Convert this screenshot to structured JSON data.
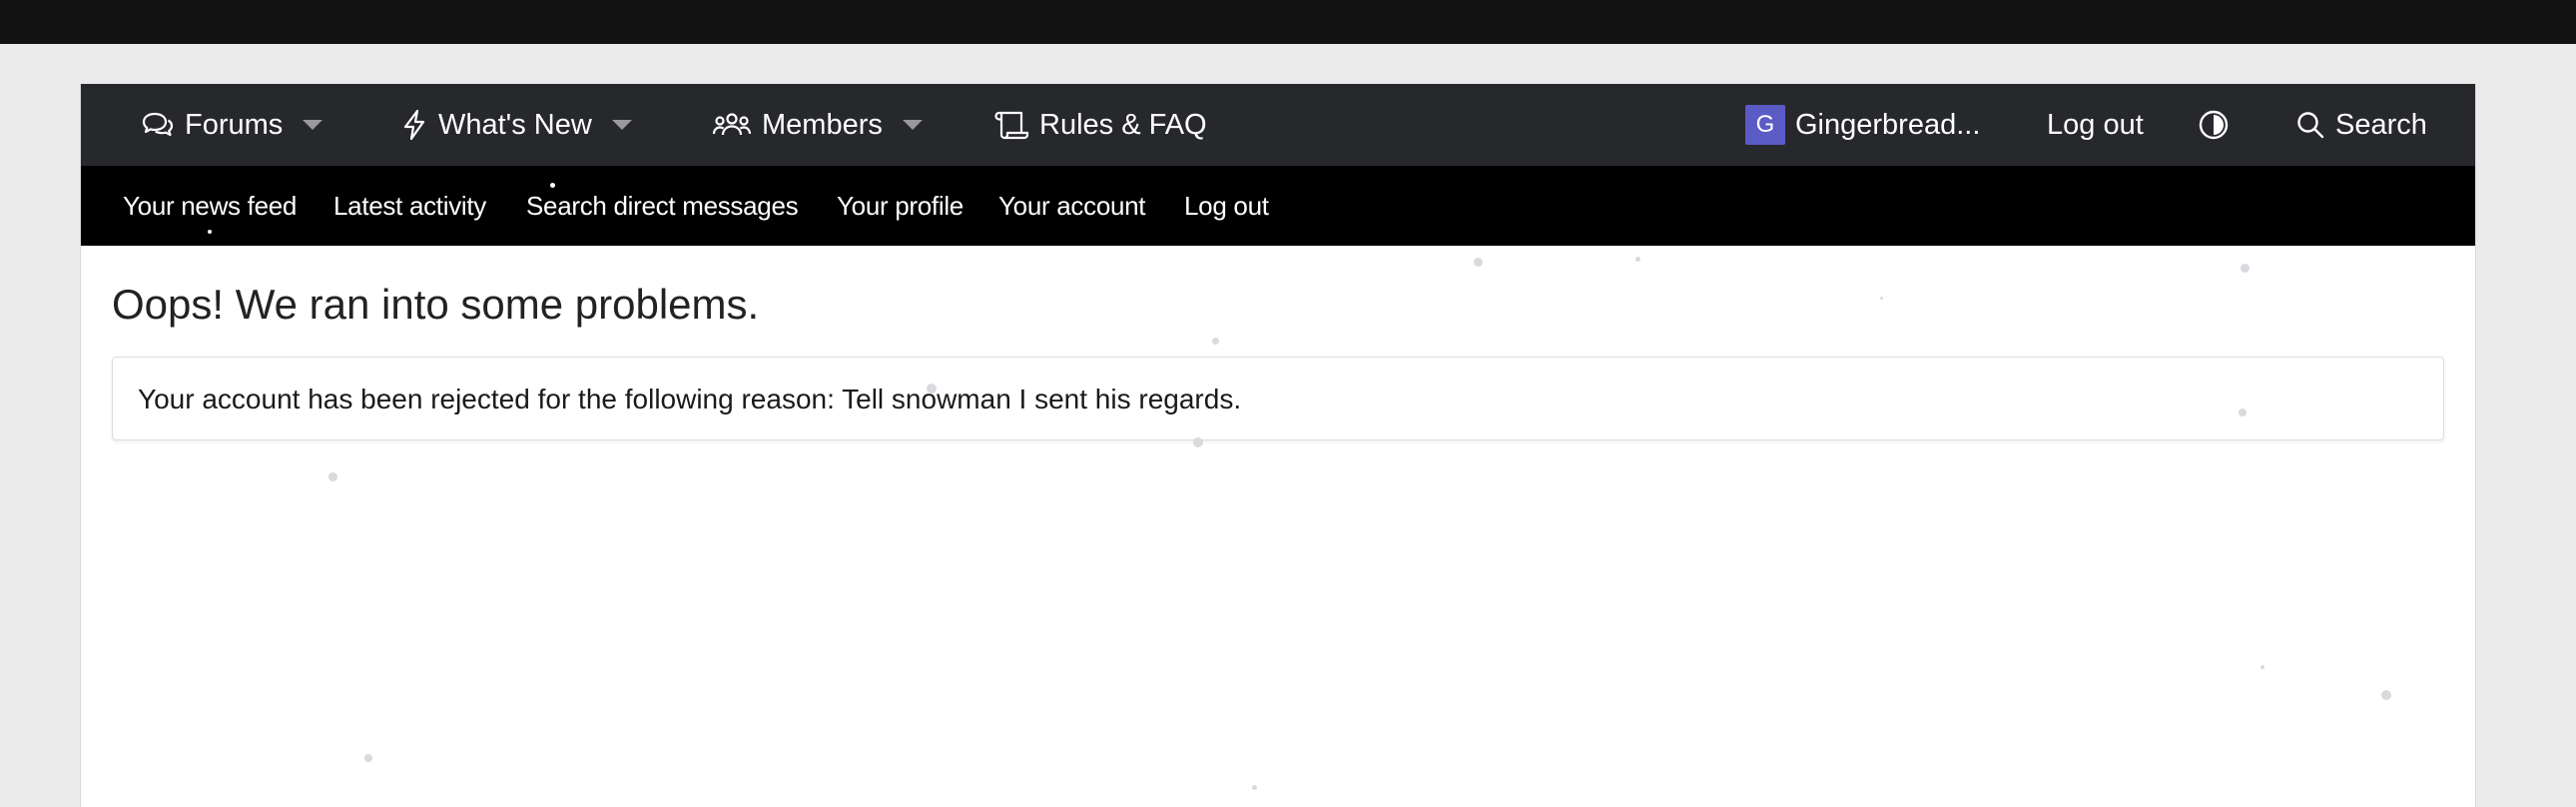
{
  "nav": {
    "forums": "Forums",
    "whats_new": "What's New",
    "members": "Members",
    "rules_faq": "Rules & FAQ",
    "user": {
      "avatar_letter": "G",
      "name": "Gingerbread..."
    },
    "logout": "Log out",
    "search": "Search"
  },
  "subnav": {
    "items": [
      "Your news feed",
      "Latest activity",
      "Search direct messages",
      "Your profile",
      "Your account",
      "Log out"
    ]
  },
  "page": {
    "title": "Oops! We ran into some problems.",
    "message": "Your account has been rejected for the following reason: Tell snowman I sent his regards."
  },
  "colors": {
    "nav_background": "#27282c",
    "subnav_background": "#000000",
    "avatar_background": "#5b5bc6",
    "page_background": "#ebebeb"
  },
  "icons": {
    "forums": "chat-bubbles-icon",
    "whats_new": "lightning-bolt-icon",
    "members": "users-icon",
    "rules_faq": "scroll-icon",
    "theme": "contrast-icon",
    "search": "search-icon",
    "dropdown": "caret-down-icon"
  }
}
